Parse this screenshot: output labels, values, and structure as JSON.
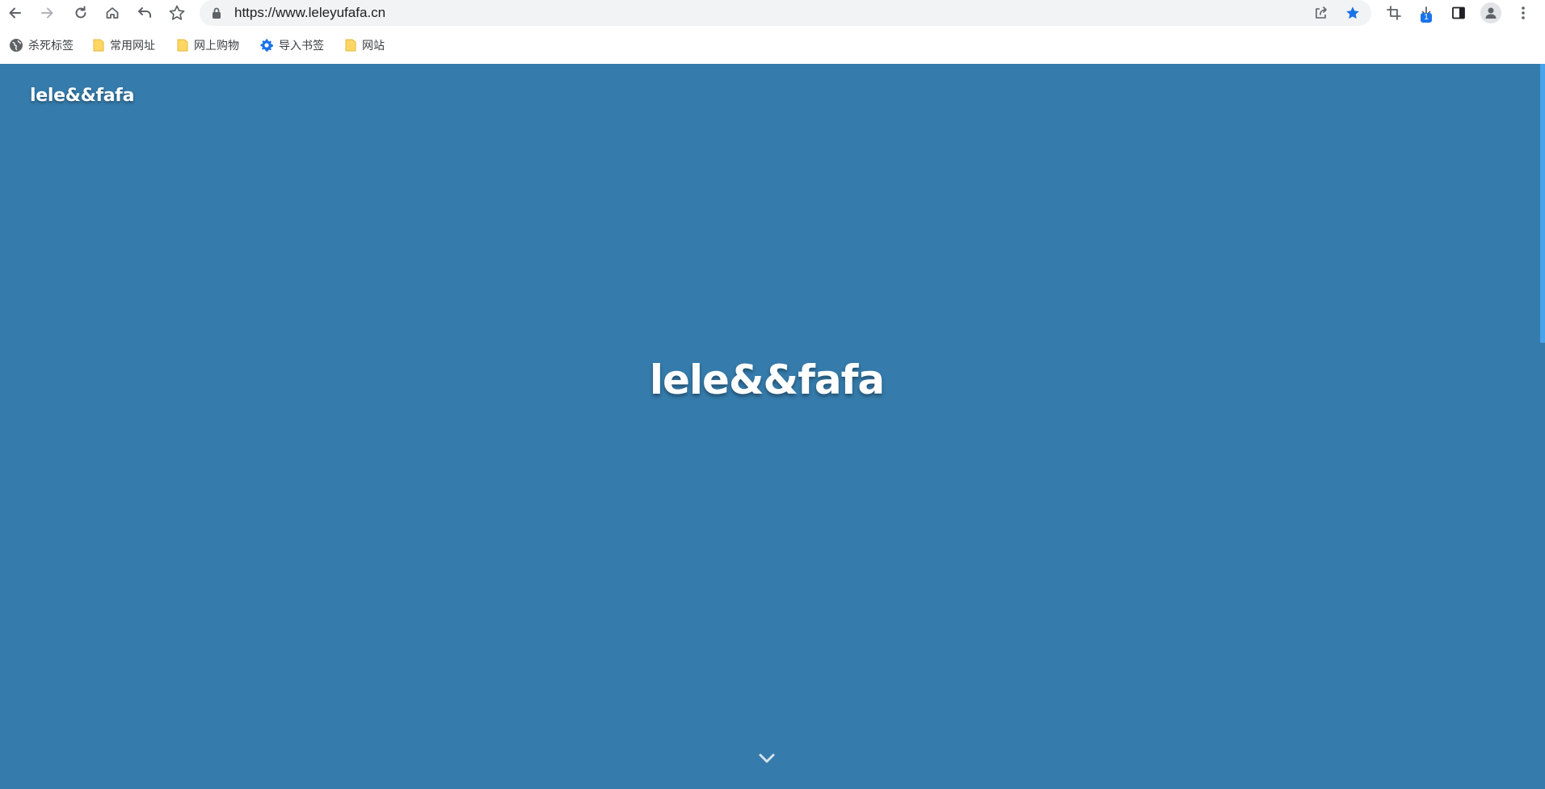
{
  "browser": {
    "url": "https://www.leleyufafa.cn",
    "download_count": "1",
    "accent_color": "#1a73e8",
    "nav_icons": [
      "back-icon",
      "forward-icon",
      "reload-icon",
      "home-icon",
      "undo-icon",
      "star-outline-icon"
    ],
    "right_icons": [
      "crop-icon",
      "download-icon",
      "side-panel-icon",
      "profile-icon",
      "menu-icon"
    ]
  },
  "bookmarks": [
    {
      "label": "杀死标签",
      "icon": "globe-icon"
    },
    {
      "label": "常用网址",
      "icon": "folder-icon"
    },
    {
      "label": "网上购物",
      "icon": "folder-icon"
    },
    {
      "label": "导入书签",
      "icon": "gear-icon"
    },
    {
      "label": "网站",
      "icon": "folder-icon"
    }
  ],
  "page": {
    "brand": "lele&&fafa",
    "hero_title": "lele&&fafa",
    "background_color": "#357bab",
    "scroll_down_icon": "chevron-down-icon"
  }
}
